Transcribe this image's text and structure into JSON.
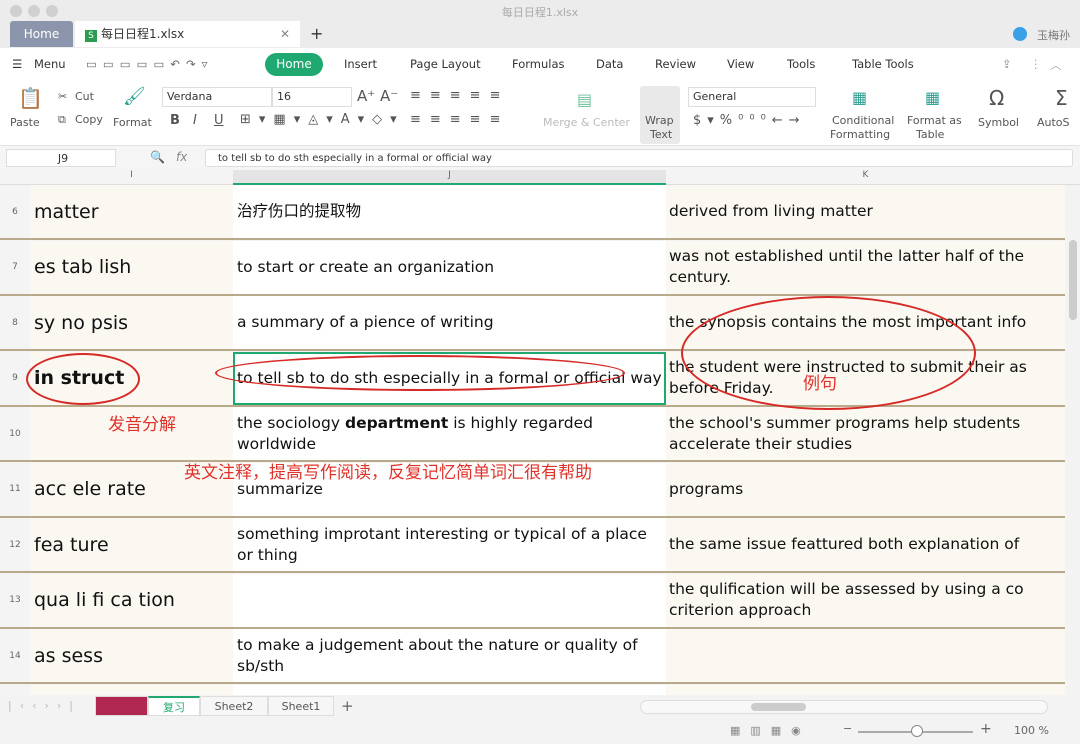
{
  "window": {
    "title": "每日日程1.xlsx"
  },
  "tabs": {
    "home": "Home",
    "file": "每日日程1.xlsx",
    "user": "玉梅孙",
    "add": "+"
  },
  "menu": {
    "menu_label": "Menu",
    "items": [
      "Home",
      "Insert",
      "Page Layout",
      "Formulas",
      "Data",
      "Review",
      "View",
      "Tools",
      "Table Tools"
    ]
  },
  "ribbon": {
    "paste": "Paste",
    "cut": "Cut",
    "copy": "Copy",
    "format": "Format",
    "font": "Verdana",
    "size": "16",
    "merge": "Merge & Center",
    "wrap1": "Wrap",
    "wrap2": "Text",
    "number_format": "General",
    "cond1": "Conditional",
    "cond2": "Formatting",
    "fat1": "Format as",
    "fat2": "Table",
    "symbol": "Symbol",
    "autosum": "AutoS",
    "bold": "B",
    "italic": "I",
    "underline": "U"
  },
  "formula": {
    "cell_ref": "J9",
    "fx": "fx",
    "value": "to tell sb to do sth especially in a formal or official way"
  },
  "columns": [
    "I",
    "J",
    "K"
  ],
  "rows": [
    {
      "n": "6",
      "i": "matter",
      "j": "治疗伤口的提取物",
      "k": "derived from living matter"
    },
    {
      "n": "7",
      "i": "es tab lish",
      "j": "to start or create an organization",
      "k": "was not established until the latter half of the century."
    },
    {
      "n": "8",
      "i": "sy no psis",
      "j": "a summary of a pience of writing",
      "k": "the synopsis contains the most important info"
    },
    {
      "n": "9",
      "i": "in struct",
      "j": "to tell sb to do sth especially in a formal or official way",
      "k": "the student were instructed to submit their as before Friday."
    },
    {
      "n": "10",
      "i": "",
      "j_pre": "the sociology ",
      "j_bold": "department",
      "j_post": " is highly regarded worldwide",
      "k": "the school's summer programs help students accelerate their studies"
    },
    {
      "n": "11",
      "i": "acc ele rate",
      "j": "summarize",
      "k": "programs"
    },
    {
      "n": "12",
      "i": "fea ture",
      "j": "something improtant interesting or typical of a place or thing",
      "k": "the same issue feattured both explanation of"
    },
    {
      "n": "13",
      "i": "qua li fi ca tion",
      "j": "",
      "k": "the qulification will be assessed by using a co criterion approach"
    },
    {
      "n": "14",
      "i": "as sess",
      "j": "to make a judgement about the nature or quality of sb/sth",
      "k": ""
    }
  ],
  "annotations": {
    "pron": "发音分解",
    "eng": "英文注释，提高写作阅读，反复记忆简单词汇很有帮助",
    "example": "例句"
  },
  "sheets": [
    "",
    "复习",
    "Sheet2",
    "Sheet1"
  ],
  "status": {
    "zoom": "100 %",
    "zoom_level": 100
  },
  "colors": {
    "accent": "#1fa971",
    "annotation": "#e0322a",
    "active_sheet": "#b0284f"
  }
}
